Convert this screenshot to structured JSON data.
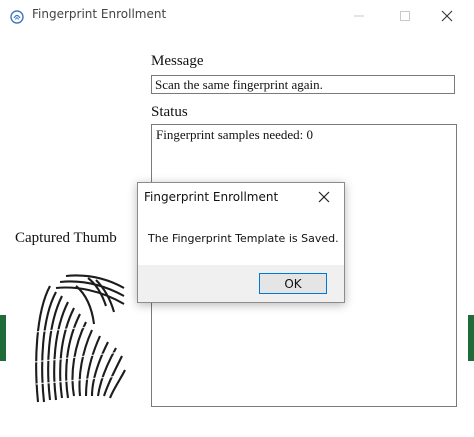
{
  "window": {
    "title": "Fingerprint Enrollment",
    "icon": "fingerprint-app-icon",
    "controls": [
      "minimize-icon",
      "maximize-icon",
      "close-icon"
    ]
  },
  "message": {
    "label": "Message",
    "value": "Scan the same fingerprint again."
  },
  "status": {
    "label": "Status",
    "value": "Fingerprint samples needed: 0"
  },
  "thumb": {
    "label": "Captured Thumb"
  },
  "dialog": {
    "title": "Fingerprint Enrollment",
    "message": "The Fingerprint Template is Saved.",
    "ok_label": "OK"
  },
  "colors": {
    "accent": "#0078d7",
    "strip": "#1f6b3a",
    "footer": "#f0f0f0"
  }
}
